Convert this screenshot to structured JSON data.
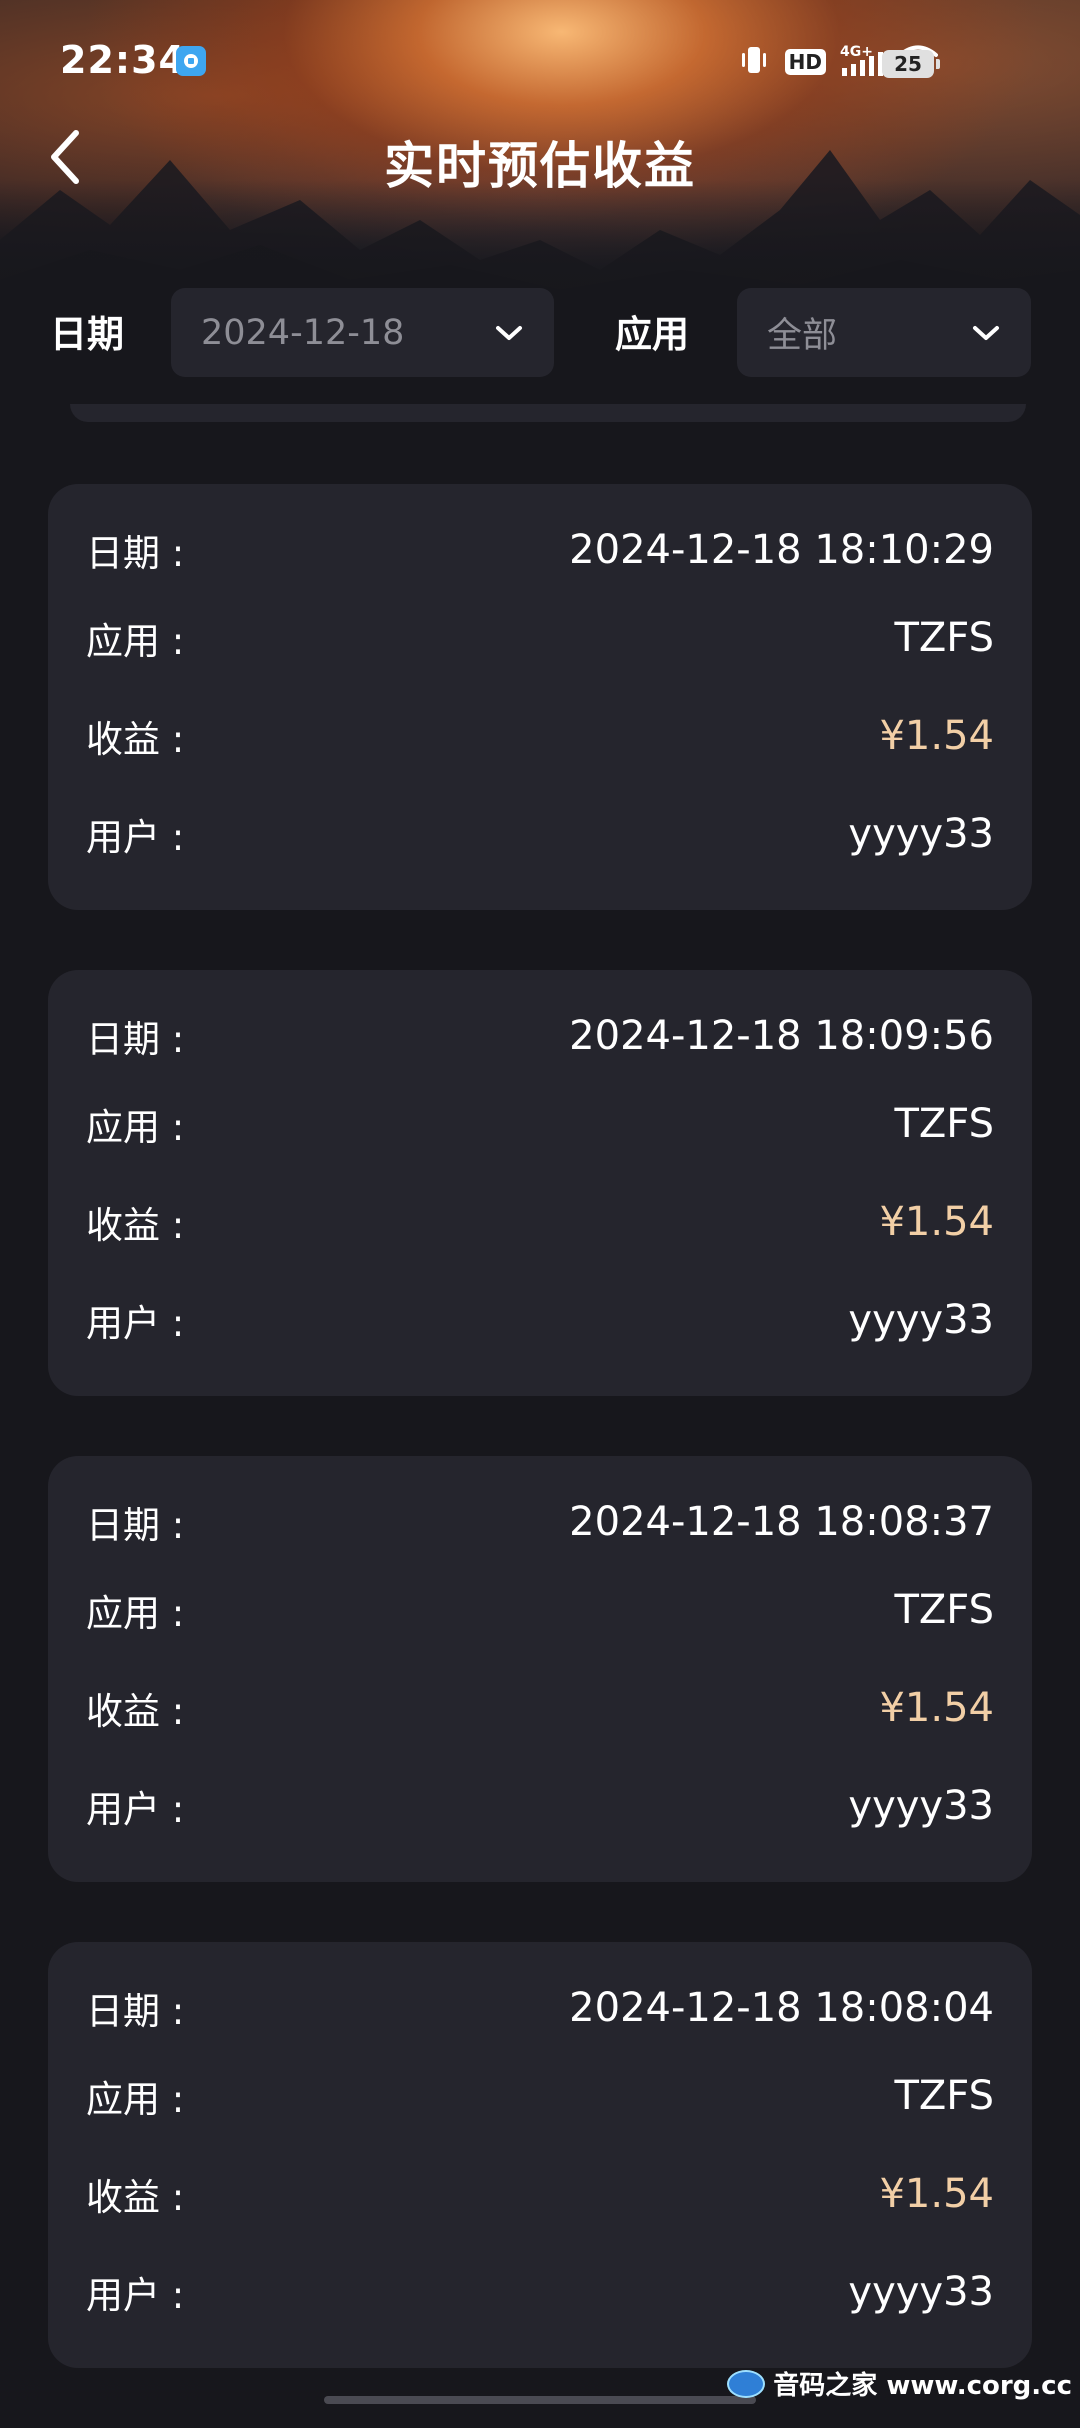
{
  "status_bar": {
    "time": "22:34",
    "hd_badge": "HD",
    "network": "4G+",
    "battery": "25",
    "icons": [
      "notification-app-icon",
      "vibrate-icon",
      "hd-icon",
      "signal-icon",
      "wifi-icon",
      "battery-icon"
    ]
  },
  "header": {
    "title": "实时预估收益",
    "back_icon": "chevron-left-icon"
  },
  "filters": {
    "date_label": "日期",
    "date_value": "2024-12-18",
    "app_label": "应用",
    "app_value": "全部"
  },
  "records": [
    {
      "date_label": "日期 :",
      "date": "2024-12-18 18:10:29",
      "app_label": "应用 :",
      "app": "TZFS",
      "income_label": "收益 :",
      "income": "¥1.54",
      "user_label": "用户 :",
      "user": "yyyy33"
    },
    {
      "date_label": "日期 :",
      "date": "2024-12-18 18:09:56",
      "app_label": "应用 :",
      "app": "TZFS",
      "income_label": "收益 :",
      "income": "¥1.54",
      "user_label": "用户 :",
      "user": "yyyy33"
    },
    {
      "date_label": "日期 :",
      "date": "2024-12-18 18:08:37",
      "app_label": "应用 :",
      "app": "TZFS",
      "income_label": "收益 :",
      "income": "¥1.54",
      "user_label": "用户 :",
      "user": "yyyy33"
    },
    {
      "date_label": "日期 :",
      "date": "2024-12-18 18:08:04",
      "app_label": "应用 :",
      "app": "TZFS",
      "income_label": "收益 :",
      "income": "¥1.54",
      "user_label": "用户 :",
      "user": "yyyy33"
    }
  ],
  "watermark": {
    "text": "音码之家 www.corg.cc"
  },
  "colors": {
    "background": "#17171c",
    "card": "#25252d",
    "income": "#f2cfa6",
    "placeholder": "#8e8e96"
  }
}
